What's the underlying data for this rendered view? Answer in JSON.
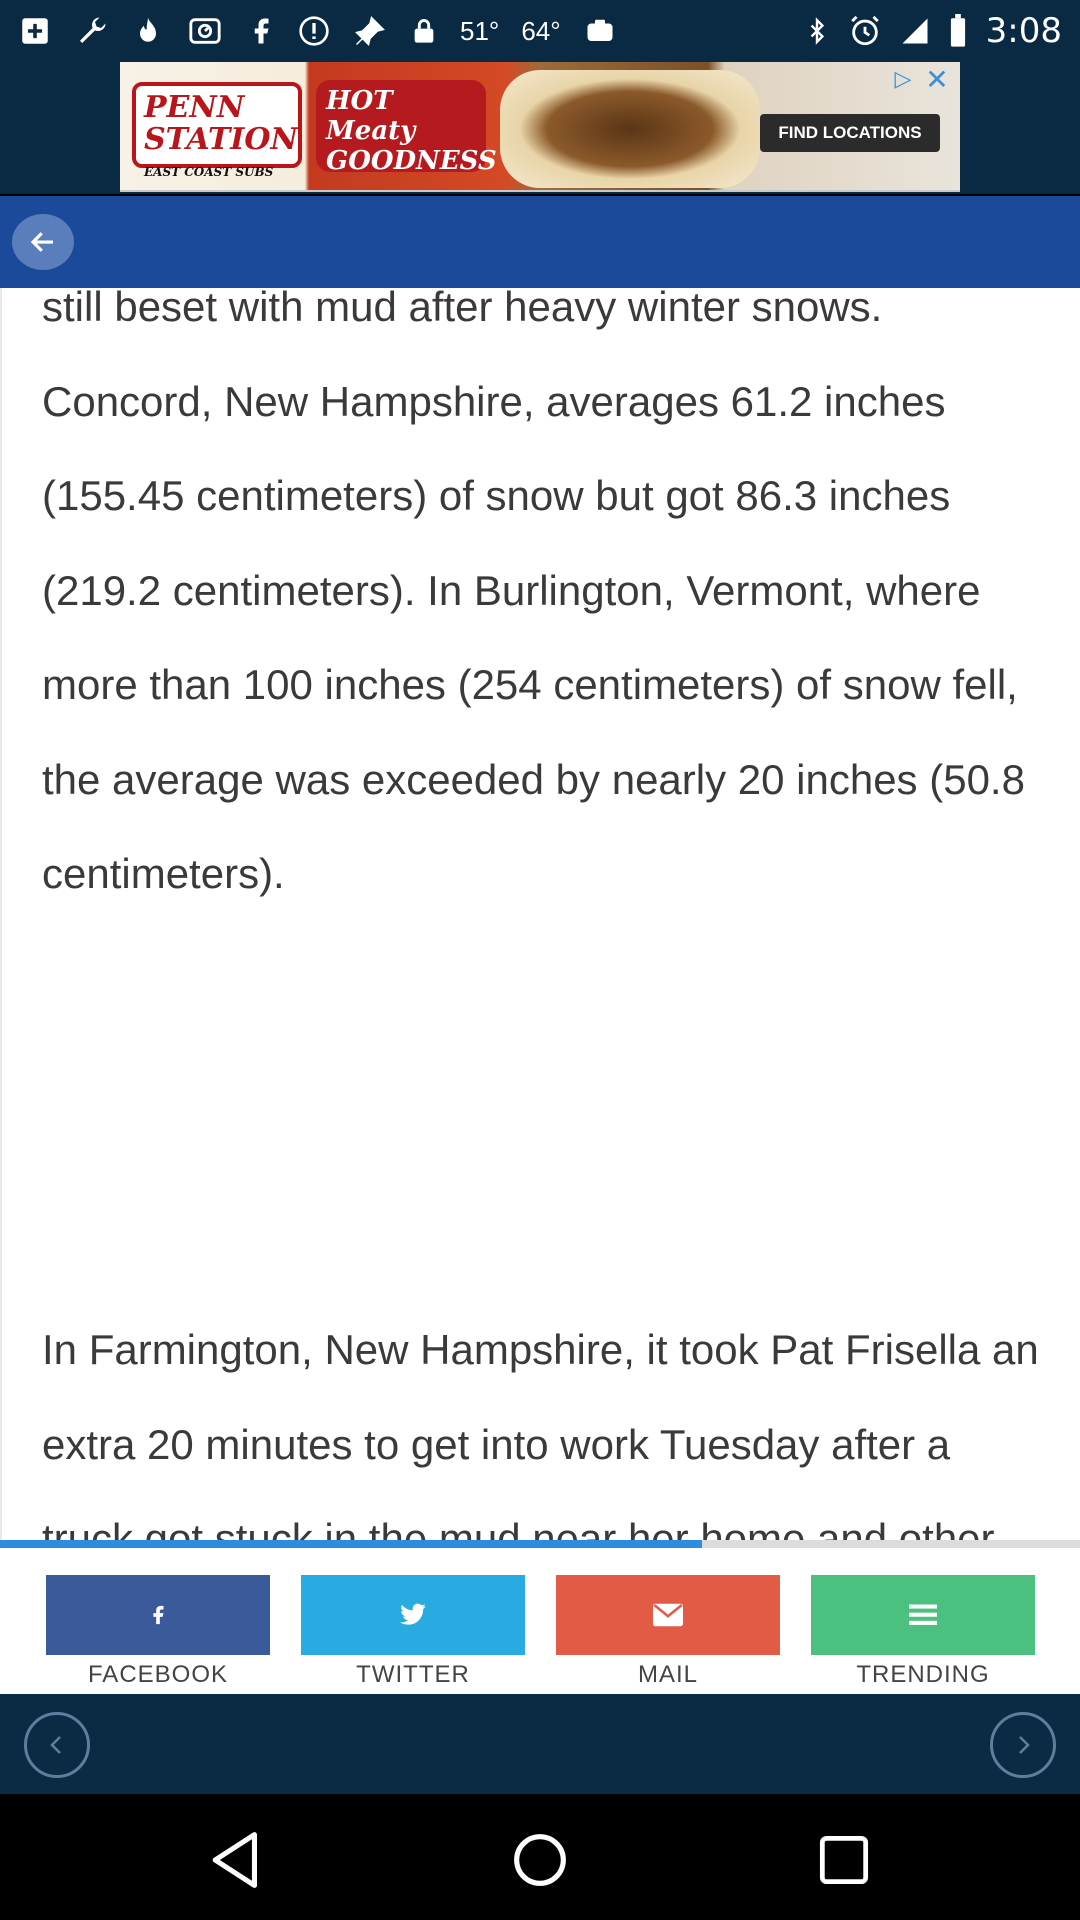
{
  "status_bar": {
    "icons": [
      "add-box-icon",
      "wrench-icon",
      "fire-icon",
      "stopwatch-icon",
      "facebook-icon",
      "alert-icon",
      "fake-gps-icon",
      "lock-icon",
      "camera-icon",
      "bluetooth-icon",
      "alarm-icon"
    ],
    "weather_1": "51°",
    "weather_2": "64°",
    "time": "3:08"
  },
  "ad": {
    "brand_line1": "PENN",
    "brand_line2": "STATION",
    "brand_sub": "EAST COAST SUBS",
    "tagline_1": "HOT",
    "tagline_2": "Meaty",
    "tagline_3": "GOODNESS",
    "cta": "FIND LOCATIONS"
  },
  "article": {
    "paragraph_1": "still beset with mud after heavy winter snows. Concord, New Hampshire, averages 61.2 inches (155.45 centimeters) of snow but got 86.3 inches (219.2 centimeters). In Burlington, Vermont, where more than 100 inches (254 centimeters) of snow fell, the average was exceeded by nearly 20 inches (50.8 centimeters).",
    "paragraph_2": "In Farmington, New Hampshire, it took Pat Frisella an extra 20 minutes to get into work Tuesday after a truck got stuck in the mud near her home and other vehicles coming to its aid blocked the road."
  },
  "reading_progress": 0.65,
  "share": {
    "facebook": {
      "label": "FACEBOOK",
      "color": "#3b5a9a"
    },
    "twitter": {
      "label": "TWITTER",
      "color": "#29aae1"
    },
    "mail": {
      "label": "MAIL",
      "color": "#e25b45"
    },
    "trending": {
      "label": "TRENDING",
      "color": "#4cc17f"
    }
  },
  "colors": {
    "app_bar": "#1c4a9b",
    "status_bar": "#0a2a44",
    "bottom_nav": "#0b2b45",
    "progress": "#2d8ce0"
  }
}
